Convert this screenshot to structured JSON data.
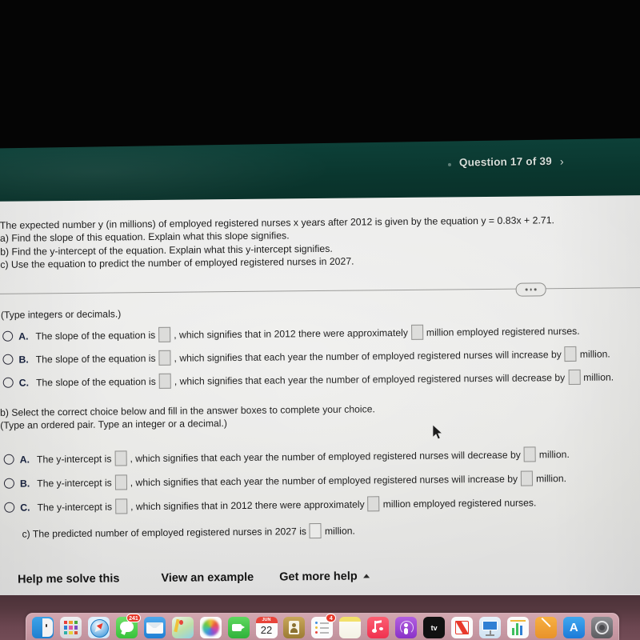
{
  "app_header": {
    "question_label": "Question 17 of 39",
    "next_arrow": "›",
    "band_color": "#0a362e"
  },
  "problem": {
    "line1": "The expected number y (in millions) of employed registered nurses x years after 2012 is given by the equation y = 0.83x + 2.71.",
    "line2": "a) Find the slope of this equation. Explain what this slope signifies.",
    "line3": "b) Find the y-intercept of the equation. Explain what this y-intercept signifies.",
    "line4": "c) Use the equation to predict the number of employed registered nurses in 2027.",
    "equation": "y = 0.83x + 2.71"
  },
  "part_a": {
    "hint": "(Type integers or decimals.)",
    "choices": [
      {
        "letter": "A.",
        "seg1": "The slope of the equation is",
        "seg2": ", which signifies that in 2012 there were approximately",
        "seg3": "million employed registered nurses.",
        "boxes": 2
      },
      {
        "letter": "B.",
        "seg1": "The slope of the equation is",
        "seg2": ", which signifies that each year the number of employed registered nurses will increase by",
        "seg3": "million.",
        "boxes": 2
      },
      {
        "letter": "C.",
        "seg1": "The slope of the equation is",
        "seg2": ", which signifies that each year the number of employed registered nurses will decrease by",
        "seg3": "million.",
        "boxes": 2
      }
    ]
  },
  "part_b": {
    "instruction": "b) Select the correct choice below and fill in the answer boxes to complete your choice.",
    "hint": "(Type an ordered pair. Type an integer or a decimal.)",
    "choices": [
      {
        "letter": "A.",
        "seg1": "The y-intercept is",
        "seg2": ", which signifies that each year the number of employed registered nurses will decrease by",
        "seg3": "million.",
        "boxes": 2
      },
      {
        "letter": "B.",
        "seg1": "The y-intercept is",
        "seg2": ", which signifies that each year the number of employed registered nurses will increase by",
        "seg3": "million.",
        "boxes": 2
      },
      {
        "letter": "C.",
        "seg1": "The y-intercept is",
        "seg2": ", which signifies that in 2012 there were approximately",
        "seg3": "million employed registered nurses.",
        "boxes": 2
      }
    ]
  },
  "part_c": {
    "seg1": "c) The predicted number of employed registered nurses in 2027 is",
    "seg2": "million."
  },
  "help_bar": {
    "solve": "Help me solve this",
    "example": "View an example",
    "more": "Get more help",
    "more_caret": "caret-up-icon"
  },
  "overflow_menu": {
    "icon": "ellipsis-icon",
    "label": "..."
  },
  "dock": {
    "items": [
      {
        "name": "finder-icon",
        "badge": ""
      },
      {
        "name": "launchpad-icon",
        "badge": ""
      },
      {
        "name": "safari-icon",
        "badge": ""
      },
      {
        "name": "messages-icon",
        "badge": "241"
      },
      {
        "name": "mail-icon",
        "badge": ""
      },
      {
        "name": "maps-icon",
        "badge": ""
      },
      {
        "name": "photos-icon",
        "badge": ""
      },
      {
        "name": "facetime-icon",
        "badge": ""
      },
      {
        "name": "calendar-icon",
        "badge": "",
        "month": "JUN",
        "day": "22"
      },
      {
        "name": "contacts-icon",
        "badge": ""
      },
      {
        "name": "reminders-icon",
        "badge": "4"
      },
      {
        "name": "notes-icon",
        "badge": ""
      },
      {
        "name": "music-icon",
        "badge": ""
      },
      {
        "name": "podcasts-icon",
        "badge": ""
      },
      {
        "name": "appletv-icon",
        "badge": "",
        "label": "tv"
      },
      {
        "name": "news-icon",
        "badge": ""
      },
      {
        "name": "keynote-icon",
        "badge": ""
      },
      {
        "name": "numbers-icon",
        "badge": ""
      },
      {
        "name": "pages-icon",
        "badge": ""
      },
      {
        "name": "app-store-icon",
        "badge": ""
      },
      {
        "name": "system-settings-icon",
        "badge": ""
      }
    ]
  }
}
